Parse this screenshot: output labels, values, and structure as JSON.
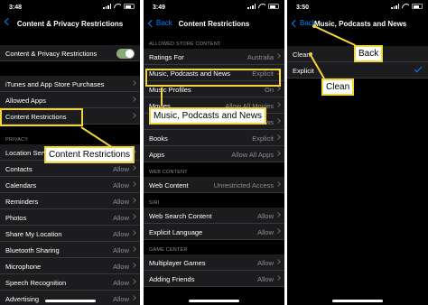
{
  "panel1": {
    "time": "3:48",
    "back_label": "",
    "title": "Content & Privacy Restrictions",
    "toggle_row": {
      "label": "Content & Privacy Restrictions",
      "on": true
    },
    "group1": [
      {
        "label": "iTunes and App Store Purchases",
        "value": ""
      },
      {
        "label": "Allowed Apps",
        "value": ""
      },
      {
        "label": "Content Restrictions",
        "value": ""
      }
    ],
    "privacy_header": "PRIVACY",
    "privacy_rows": [
      {
        "label": "Location Services",
        "value": ""
      },
      {
        "label": "Contacts",
        "value": "Allow"
      },
      {
        "label": "Calendars",
        "value": "Allow"
      },
      {
        "label": "Reminders",
        "value": "Allow"
      },
      {
        "label": "Photos",
        "value": "Allow"
      },
      {
        "label": "Share My Location",
        "value": "Allow"
      },
      {
        "label": "Bluetooth Sharing",
        "value": "Allow"
      },
      {
        "label": "Microphone",
        "value": "Allow"
      },
      {
        "label": "Speech Recognition",
        "value": "Allow"
      },
      {
        "label": "Advertising",
        "value": "Allow"
      }
    ],
    "callout": "Content Restrictions"
  },
  "panel2": {
    "time": "3:49",
    "back_label": "Back",
    "title": "Content Restrictions",
    "store_header": "ALLOWED STORE CONTENT",
    "store_rows": [
      {
        "label": "Ratings For",
        "value": "Australia"
      },
      {
        "label": "Music, Podcasts and News",
        "value": "Explicit"
      },
      {
        "label": "Music Profiles",
        "value": "On"
      },
      {
        "label": "Movies",
        "value": "Allow All Movies"
      },
      {
        "label": "TV Shows",
        "value": "Allow All TV Shows"
      },
      {
        "label": "Books",
        "value": "Explicit"
      },
      {
        "label": "Apps",
        "value": "Allow All Apps"
      }
    ],
    "web_header": "WEB CONTENT",
    "web_rows": [
      {
        "label": "Web Content",
        "value": "Unrestricted Access"
      }
    ],
    "siri_header": "SIRI",
    "siri_rows": [
      {
        "label": "Web Search Content",
        "value": "Allow"
      },
      {
        "label": "Explicit Language",
        "value": "Allow"
      }
    ],
    "game_header": "GAME CENTER",
    "game_rows": [
      {
        "label": "Multiplayer Games",
        "value": "Allow"
      },
      {
        "label": "Adding Friends",
        "value": "Allow"
      }
    ],
    "callout": "Music, Podcasts and News"
  },
  "panel3": {
    "time": "3:50",
    "back_label": "Back",
    "title": "Music, Podcasts and News",
    "options": [
      {
        "label": "Clean",
        "selected": false
      },
      {
        "label": "Explicit",
        "selected": true
      }
    ],
    "callout_back": "Back",
    "callout_clean": "Clean"
  },
  "colors": {
    "accent": "#0a84ff",
    "highlight": "#f2d43b",
    "toggle_on": "#8aaa7a"
  },
  "icons": [
    "back-chevron-icon",
    "disclosure-chevron-icon",
    "checkmark-icon",
    "signal-icon",
    "wifi-icon",
    "battery-icon"
  ]
}
